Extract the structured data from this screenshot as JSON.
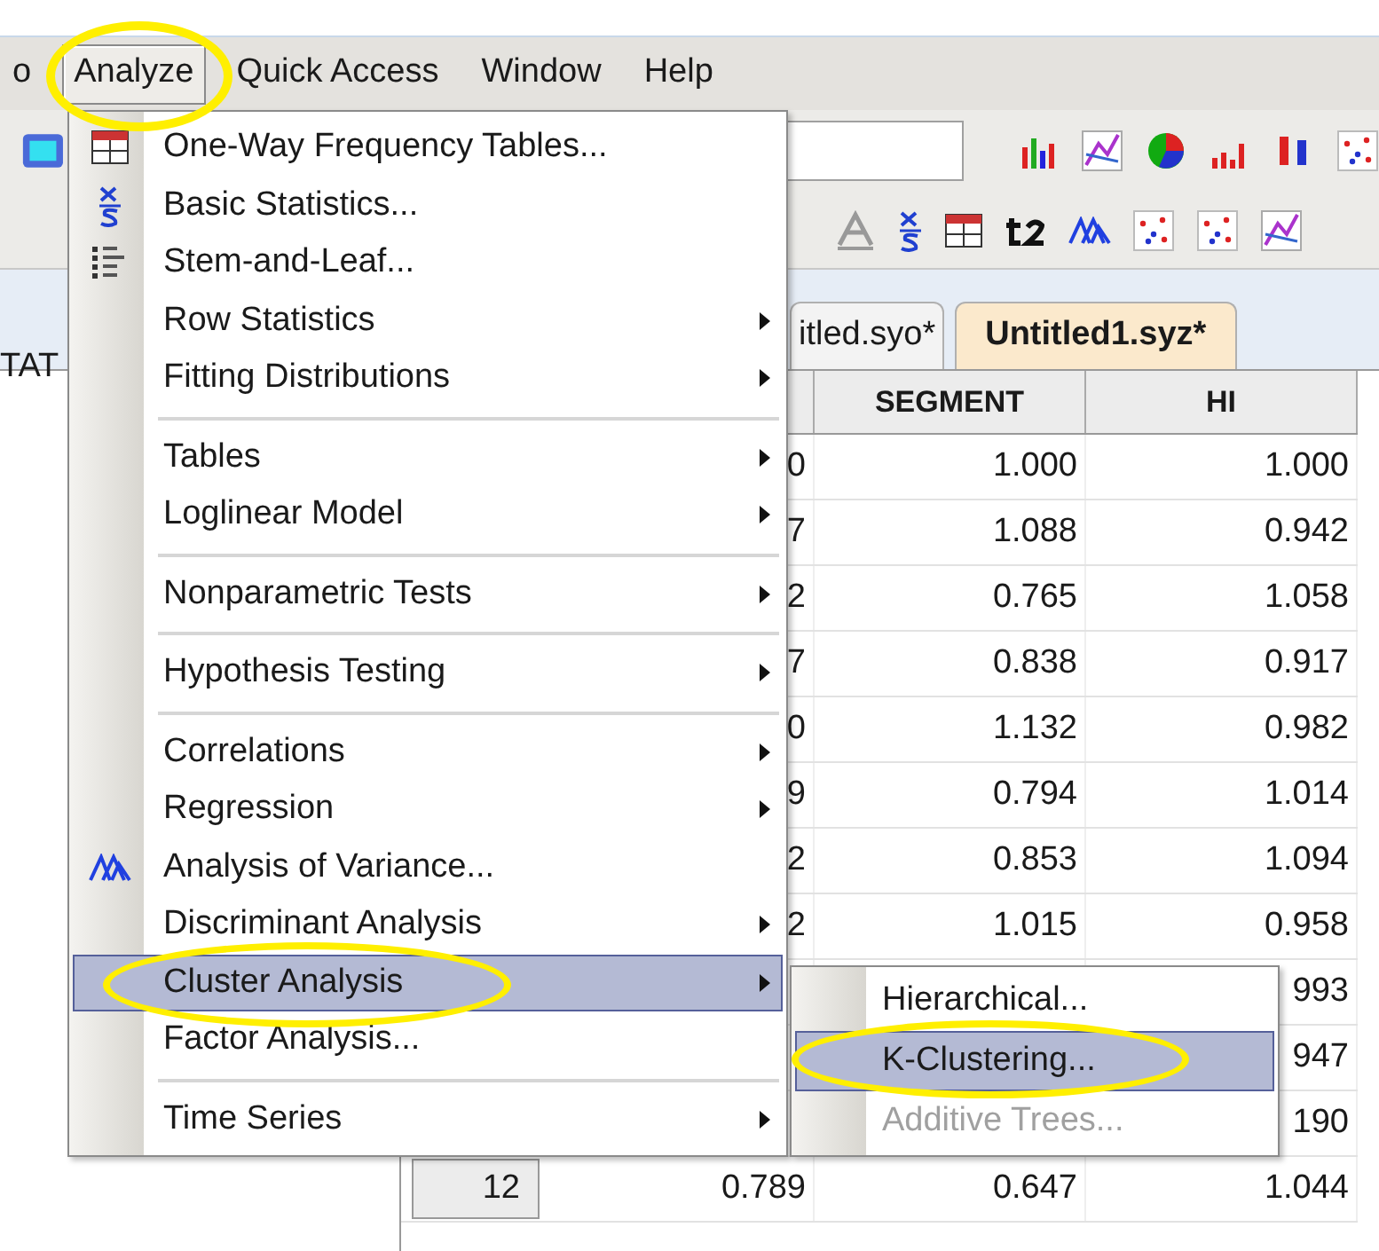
{
  "menubar": [
    {
      "label": "o",
      "selected": false
    },
    {
      "label": "Analyze",
      "selected": true
    },
    {
      "label": "Quick Access",
      "selected": false
    },
    {
      "label": "Window",
      "selected": false
    },
    {
      "label": "Help",
      "selected": false
    }
  ],
  "side_panel": {
    "text": "TAT"
  },
  "tabs": [
    {
      "label": "itled.syo*",
      "selected": false
    },
    {
      "label": "Untitled1.syz*",
      "selected": true
    }
  ],
  "grid": {
    "columns": [
      null,
      "SEGMENT",
      "HI"
    ],
    "rows": [
      {
        "cells": [
          "0",
          "1.000",
          "1.000"
        ]
      },
      {
        "cells": [
          "7",
          "1.088",
          "0.942"
        ]
      },
      {
        "cells": [
          "2",
          "0.765",
          "1.058"
        ]
      },
      {
        "cells": [
          "7",
          "0.838",
          "0.917"
        ]
      },
      {
        "cells": [
          "0",
          "1.132",
          "0.982"
        ]
      },
      {
        "cells": [
          "9",
          "0.794",
          "1.014"
        ]
      },
      {
        "cells": [
          "2",
          "0.853",
          "1.094"
        ]
      },
      {
        "cells": [
          "2",
          "1.015",
          "0.958"
        ]
      },
      {
        "cells": [
          null,
          null,
          "993"
        ]
      },
      {
        "cells": [
          null,
          null,
          "947"
        ]
      },
      {
        "cells": [
          null,
          null,
          "190"
        ]
      },
      {
        "header": "12",
        "cells": [
          "0.789",
          "0.647",
          "1.044"
        ]
      }
    ]
  },
  "menu": {
    "items": [
      {
        "kind": "item",
        "label": "One-Way Frequency Tables...",
        "submenu": false,
        "selected": false
      },
      {
        "kind": "item",
        "label": "Basic Statistics...",
        "submenu": false,
        "selected": false
      },
      {
        "kind": "item",
        "label": "Stem-and-Leaf...",
        "submenu": false,
        "selected": false
      },
      {
        "kind": "item",
        "label": "Row Statistics",
        "submenu": true,
        "selected": false
      },
      {
        "kind": "item",
        "label": "Fitting Distributions",
        "submenu": true,
        "selected": false
      },
      {
        "kind": "separator"
      },
      {
        "kind": "item",
        "label": "Tables",
        "submenu": true,
        "selected": false
      },
      {
        "kind": "item",
        "label": "Loglinear Model",
        "submenu": true,
        "selected": false
      },
      {
        "kind": "separator"
      },
      {
        "kind": "item",
        "label": "Nonparametric Tests",
        "submenu": true,
        "selected": false
      },
      {
        "kind": "separator"
      },
      {
        "kind": "item",
        "label": "Hypothesis Testing",
        "submenu": true,
        "selected": false
      },
      {
        "kind": "separator"
      },
      {
        "kind": "item",
        "label": "Correlations",
        "submenu": true,
        "selected": false
      },
      {
        "kind": "item",
        "label": "Regression",
        "submenu": true,
        "selected": false
      },
      {
        "kind": "item",
        "label": "Analysis of Variance...",
        "submenu": false,
        "selected": false
      },
      {
        "kind": "item",
        "label": "Discriminant Analysis",
        "submenu": true,
        "selected": false
      },
      {
        "kind": "item",
        "label": "Cluster Analysis",
        "submenu": true,
        "selected": true
      },
      {
        "kind": "item",
        "label": "Factor Analysis...",
        "submenu": false,
        "selected": false
      },
      {
        "kind": "separator"
      },
      {
        "kind": "item",
        "label": "Time Series",
        "submenu": true,
        "selected": false
      }
    ]
  },
  "submenu": {
    "items": [
      {
        "label": "Hierarchical...",
        "selected": false,
        "disabled": false
      },
      {
        "label": "K-Clustering...",
        "selected": true,
        "disabled": false
      },
      {
        "label": "Additive Trees...",
        "selected": false,
        "disabled": true
      }
    ]
  }
}
